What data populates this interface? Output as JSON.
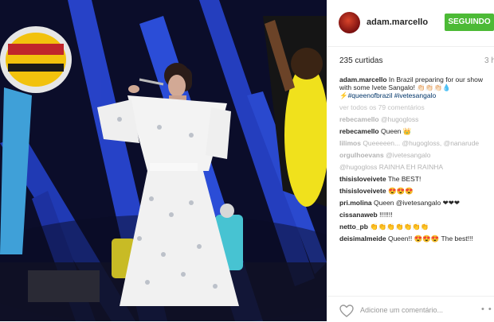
{
  "post": {
    "username": "adam.marcello",
    "follow_label": "SEGUINDO",
    "likes": "235 curtidas",
    "time": "3 h",
    "caption_user": "adam.marcello",
    "caption_text": "In Brazil preparing for our show with some Ivete Sangalo! 👏🏻👏🏻👏🏻💧",
    "caption_tags": "⚡#queenofbrazil #ivetesangalo",
    "view_all": "ver todos os 79 comentários",
    "comments": [
      {
        "user": "rebecamello",
        "text": "@hugogloss",
        "faded": true
      },
      {
        "user": "rebecamello",
        "text": "Queen 👑",
        "faded": false
      },
      {
        "user": "lilimos",
        "text": "Queeeeen... @hugogloss, @nanarude",
        "faded": true
      },
      {
        "user": "orgulhoevans",
        "text": "@ivetesangalo",
        "faded": true
      },
      {
        "user": "",
        "text": "@hugogloss RAINHA EH RAINHA",
        "faded": true
      },
      {
        "user": "thisisloveivete",
        "text": "The BEST!",
        "faded": false
      },
      {
        "user": "thisisloveivete",
        "text": "😍😍😍",
        "faded": false
      },
      {
        "user": "pri.molina",
        "text": "Queen @ivetesangalo ❤❤❤",
        "faded": false
      },
      {
        "user": "cissanaweb",
        "text": "!!!!!!!",
        "faded": false
      },
      {
        "user": "netto_pb",
        "text": "👏👏👏👏👏👏👏",
        "faded": false
      },
      {
        "user": "deisimalmeide",
        "text": "Queen!! 😍😍😍 The best!!!",
        "faded": false
      }
    ],
    "add_comment_placeholder": "Adicione um comentário...",
    "more_label": "• •"
  }
}
